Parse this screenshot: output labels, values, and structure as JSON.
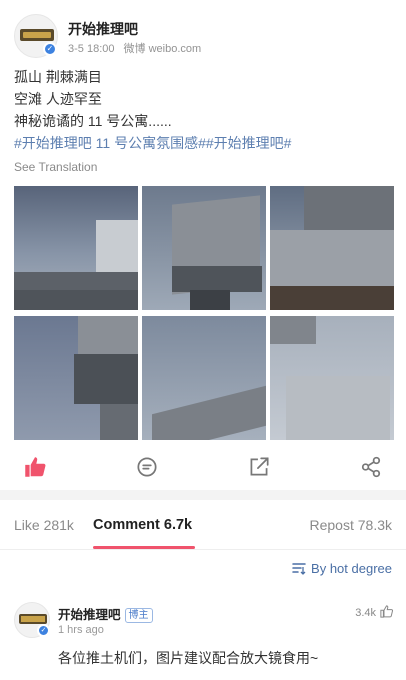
{
  "post": {
    "author": "开始推理吧",
    "time": "3-5 18:00",
    "source": "微博 weibo.com",
    "lines": [
      "孤山 荆棘满目",
      "空滩 人迹罕至",
      "神秘诡谲的 11 号公寓......"
    ],
    "tags": "#开始推理吧 11 号公寓氛围感##开始推理吧#",
    "see_translation": "See Translation",
    "image_count": 6
  },
  "actions": {
    "like_icon": "thumbs-up-icon",
    "comment_icon": "comment-icon",
    "repost_icon": "repost-icon",
    "share_icon": "share-icon",
    "like_color": "#f0536c"
  },
  "tabs": {
    "like": "Like 281k",
    "comment": "Comment 6.7k",
    "repost": "Repost 78.3k",
    "accent": "#f0536c"
  },
  "sort": {
    "label": "By hot degree",
    "icon": "sort-icon"
  },
  "comments": [
    {
      "author": "开始推理吧",
      "badge": "博主",
      "time": "1 hrs ago",
      "likes": "3.4k",
      "text": "各位推土机们，图片建议配合放大镜食用~"
    }
  ]
}
